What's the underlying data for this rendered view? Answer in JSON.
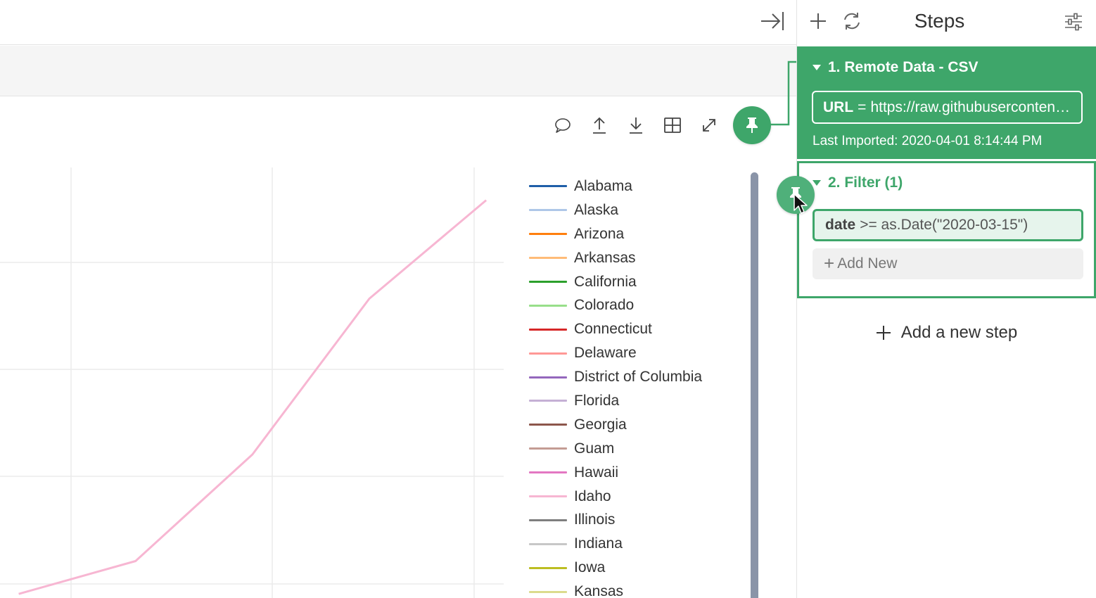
{
  "steps_panel": {
    "title": "Steps",
    "steps": [
      {
        "label": "1. Remote Data - CSV",
        "param_key": "URL",
        "param_op": "=",
        "param_value": "https://raw.githubusercontent.com/",
        "last_imported": "Last Imported: 2020-04-01 8:14:44 PM"
      },
      {
        "label": "2. Filter (1)",
        "filter_key": "date",
        "filter_expr": ">= as.Date(\"2020-03-15\")",
        "add_new_label": "Add New"
      }
    ],
    "add_new_step_label": "Add a new step"
  },
  "colors": {
    "accent": "#3ea66a",
    "scrollbar": "#8a94a8"
  },
  "legend": {
    "items": [
      {
        "label": "Alabama",
        "color": "#1f5fa8"
      },
      {
        "label": "Alaska",
        "color": "#aec7e8"
      },
      {
        "label": "Arizona",
        "color": "#ff7f0e"
      },
      {
        "label": "Arkansas",
        "color": "#ffbb78"
      },
      {
        "label": "California",
        "color": "#2ca02c"
      },
      {
        "label": "Colorado",
        "color": "#98df8a"
      },
      {
        "label": "Connecticut",
        "color": "#d62728"
      },
      {
        "label": "Delaware",
        "color": "#ff9896"
      },
      {
        "label": "District of Columbia",
        "color": "#9467bd"
      },
      {
        "label": "Florida",
        "color": "#c5b0d5"
      },
      {
        "label": "Georgia",
        "color": "#8c564b"
      },
      {
        "label": "Guam",
        "color": "#c49c94"
      },
      {
        "label": "Hawaii",
        "color": "#e377c2"
      },
      {
        "label": "Idaho",
        "color": "#f7b6d2"
      },
      {
        "label": "Illinois",
        "color": "#7f7f7f"
      },
      {
        "label": "Indiana",
        "color": "#c7c7c7"
      },
      {
        "label": "Iowa",
        "color": "#bcbd22"
      },
      {
        "label": "Kansas",
        "color": "#dbdb8d"
      }
    ]
  },
  "chart_data": {
    "type": "line",
    "grid": true,
    "series": [
      {
        "name": "Idaho",
        "color": "#f7b6d2",
        "x": [
          0,
          1,
          2,
          3,
          4
        ],
        "y": [
          0,
          0.4,
          1.7,
          3.6,
          4.8
        ]
      }
    ]
  }
}
